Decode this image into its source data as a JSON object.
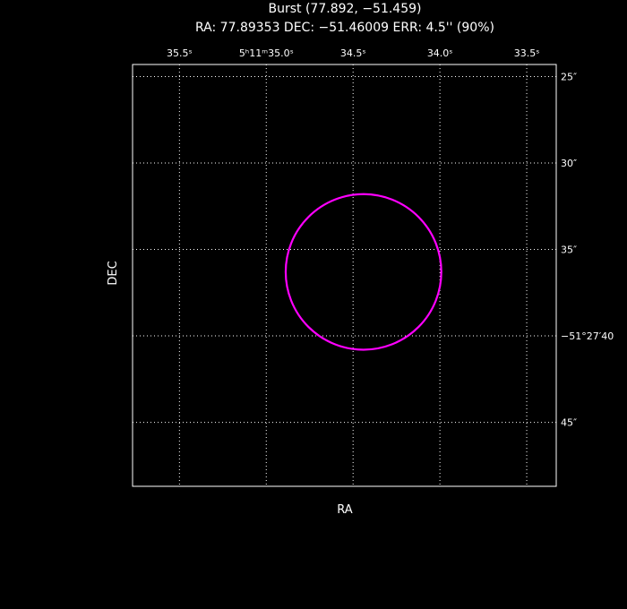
{
  "chart_data": {
    "type": "scatter",
    "title": "Burst (77.892, −51.459)",
    "subtitle": "RA: 77.89353   DEC: −51.46009   ERR: 4.5'' (90%)",
    "xlabel": "RA",
    "ylabel": "DEC",
    "x_ticks": [
      {
        "value": 35.5,
        "label": "35.5ˢ"
      },
      {
        "value": 35.0,
        "label": "5ʰ11ᵐ35.0ˢ"
      },
      {
        "value": 34.5,
        "label": "34.5ˢ"
      },
      {
        "value": 34.0,
        "label": "34.0ˢ"
      },
      {
        "value": 33.5,
        "label": "33.5ˢ"
      }
    ],
    "y_ticks": [
      {
        "value": 25,
        "label": "25″"
      },
      {
        "value": 30,
        "label": "30″"
      },
      {
        "value": 35,
        "label": "35″"
      },
      {
        "value": 40,
        "label": "−51°27′40"
      },
      {
        "value": 45,
        "label": "45″"
      }
    ],
    "xlim": [
      35.77,
      33.33
    ],
    "ylim": [
      24.3,
      48.7
    ],
    "grid": true,
    "error_circle": {
      "center_ra_sec": 34.44,
      "center_dec_arcsec": 36.3,
      "radius_arcsec": 4.5,
      "color": "#ff00ff"
    }
  }
}
